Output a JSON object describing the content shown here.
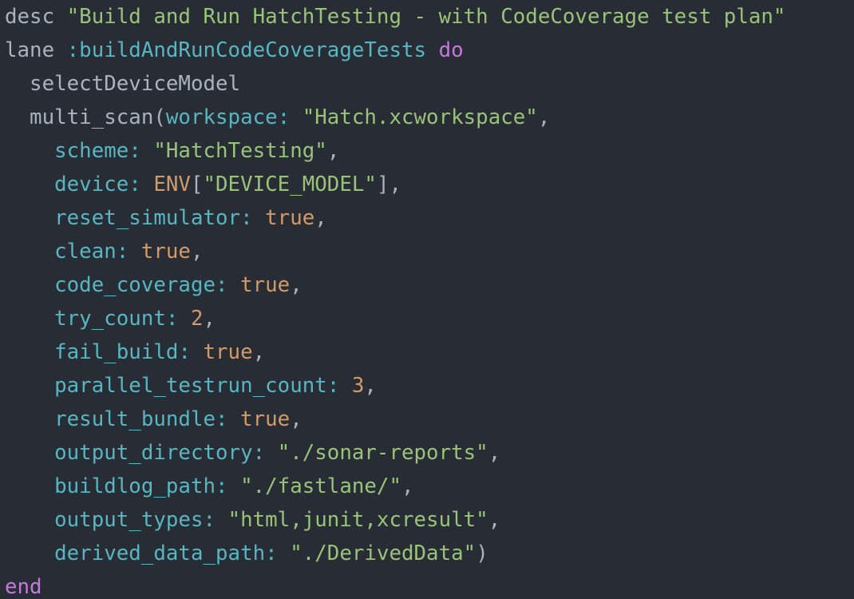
{
  "editor": {
    "colors": {
      "background": "#282c34",
      "text": "#abb2bf",
      "string": "#98c379",
      "symbol": "#56b6c2",
      "keyword": "#c678dd",
      "key": "#56b6c2",
      "number": "#d19a66",
      "bool": "#d19a66",
      "const": "#d19a66"
    },
    "lines": [
      [
        {
          "t": "desc ",
          "k": "text"
        },
        {
          "t": "\"Build and Run HatchTesting - with CodeCoverage test plan\"",
          "k": "string"
        }
      ],
      [
        {
          "t": "lane ",
          "k": "text"
        },
        {
          "t": ":buildAndRunCodeCoverageTests",
          "k": "symbol"
        },
        {
          "t": " ",
          "k": "text"
        },
        {
          "t": "do",
          "k": "keyword"
        }
      ],
      [
        {
          "t": "  selectDeviceModel",
          "k": "text"
        }
      ],
      [
        {
          "t": "  multi_scan(",
          "k": "text"
        },
        {
          "t": "workspace",
          "k": "key"
        },
        {
          "t": ": ",
          "k": "key"
        },
        {
          "t": "\"Hatch.xcworkspace\"",
          "k": "string"
        },
        {
          "t": ",",
          "k": "punct"
        }
      ],
      [
        {
          "t": "    ",
          "k": "text"
        },
        {
          "t": "scheme",
          "k": "key"
        },
        {
          "t": ": ",
          "k": "key"
        },
        {
          "t": "\"HatchTesting\"",
          "k": "string"
        },
        {
          "t": ",",
          "k": "punct"
        }
      ],
      [
        {
          "t": "    ",
          "k": "text"
        },
        {
          "t": "device",
          "k": "key"
        },
        {
          "t": ": ",
          "k": "key"
        },
        {
          "t": "ENV",
          "k": "const"
        },
        {
          "t": "[",
          "k": "punct"
        },
        {
          "t": "\"DEVICE_MODEL\"",
          "k": "string"
        },
        {
          "t": "],",
          "k": "punct"
        }
      ],
      [
        {
          "t": "    ",
          "k": "text"
        },
        {
          "t": "reset_simulator",
          "k": "key"
        },
        {
          "t": ": ",
          "k": "key"
        },
        {
          "t": "true",
          "k": "bool"
        },
        {
          "t": ",",
          "k": "punct"
        }
      ],
      [
        {
          "t": "    ",
          "k": "text"
        },
        {
          "t": "clean",
          "k": "key"
        },
        {
          "t": ": ",
          "k": "key"
        },
        {
          "t": "true",
          "k": "bool"
        },
        {
          "t": ",",
          "k": "punct"
        }
      ],
      [
        {
          "t": "    ",
          "k": "text"
        },
        {
          "t": "code_coverage",
          "k": "key"
        },
        {
          "t": ": ",
          "k": "key"
        },
        {
          "t": "true",
          "k": "bool"
        },
        {
          "t": ",",
          "k": "punct"
        }
      ],
      [
        {
          "t": "    ",
          "k": "text"
        },
        {
          "t": "try_count",
          "k": "key"
        },
        {
          "t": ": ",
          "k": "key"
        },
        {
          "t": "2",
          "k": "number"
        },
        {
          "t": ",",
          "k": "punct"
        }
      ],
      [
        {
          "t": "    ",
          "k": "text"
        },
        {
          "t": "fail_build",
          "k": "key"
        },
        {
          "t": ": ",
          "k": "key"
        },
        {
          "t": "true",
          "k": "bool"
        },
        {
          "t": ",",
          "k": "punct"
        }
      ],
      [
        {
          "t": "    ",
          "k": "text"
        },
        {
          "t": "parallel_testrun_count",
          "k": "key"
        },
        {
          "t": ": ",
          "k": "key"
        },
        {
          "t": "3",
          "k": "number"
        },
        {
          "t": ",",
          "k": "punct"
        }
      ],
      [
        {
          "t": "    ",
          "k": "text"
        },
        {
          "t": "result_bundle",
          "k": "key"
        },
        {
          "t": ": ",
          "k": "key"
        },
        {
          "t": "true",
          "k": "bool"
        },
        {
          "t": ",",
          "k": "punct"
        }
      ],
      [
        {
          "t": "    ",
          "k": "text"
        },
        {
          "t": "output_directory",
          "k": "key"
        },
        {
          "t": ": ",
          "k": "key"
        },
        {
          "t": "\"./sonar-reports\"",
          "k": "string"
        },
        {
          "t": ",",
          "k": "punct"
        }
      ],
      [
        {
          "t": "    ",
          "k": "text"
        },
        {
          "t": "buildlog_path",
          "k": "key"
        },
        {
          "t": ": ",
          "k": "key"
        },
        {
          "t": "\"./fastlane/\"",
          "k": "string"
        },
        {
          "t": ",",
          "k": "punct"
        }
      ],
      [
        {
          "t": "    ",
          "k": "text"
        },
        {
          "t": "output_types",
          "k": "key"
        },
        {
          "t": ": ",
          "k": "key"
        },
        {
          "t": "\"html,junit,xcresult\"",
          "k": "string"
        },
        {
          "t": ",",
          "k": "punct"
        }
      ],
      [
        {
          "t": "    ",
          "k": "text"
        },
        {
          "t": "derived_data_path",
          "k": "key"
        },
        {
          "t": ": ",
          "k": "key"
        },
        {
          "t": "\"./DerivedData\"",
          "k": "string"
        },
        {
          "t": ")",
          "k": "punct"
        }
      ],
      [
        {
          "t": "end",
          "k": "keyword"
        }
      ]
    ]
  }
}
